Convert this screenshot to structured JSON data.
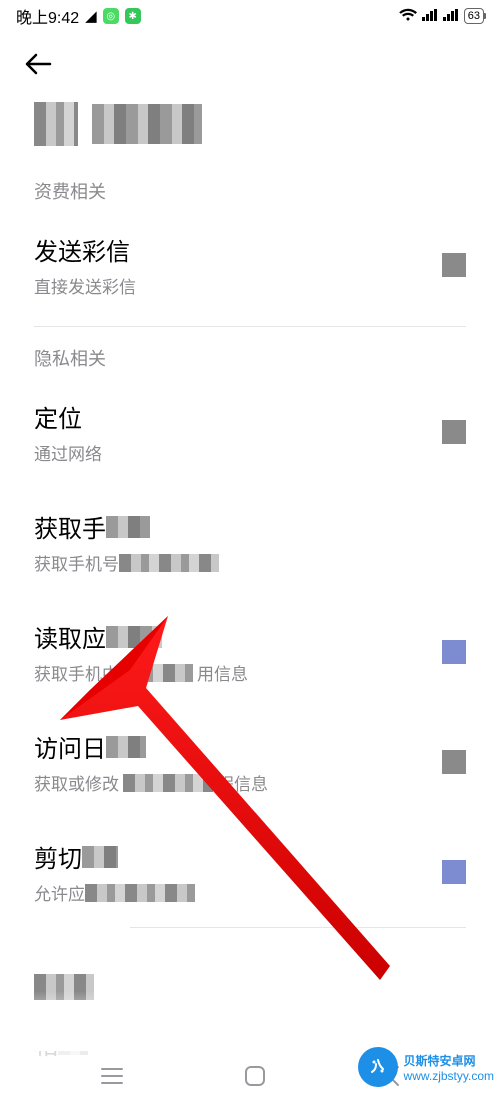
{
  "status": {
    "time": "晚上9:42",
    "battery": "63"
  },
  "sections": {
    "fee": "资费相关",
    "privacy": "隐私相关"
  },
  "rows": {
    "mms": {
      "title": "发送彩信",
      "sub": "直接发送彩信"
    },
    "location": {
      "title": "定位",
      "sub": "通过网络"
    },
    "phone": {
      "title_prefix": "获取手",
      "sub_prefix": "获取手机号"
    },
    "apps": {
      "title_prefix": "读取应",
      "sub_prefix": "获取手机中",
      "sub_suffix": "用信息"
    },
    "calendar": {
      "title_prefix": "访问日",
      "sub_prefix": "获取或修改",
      "sub_suffix": "程信息"
    },
    "clipboard": {
      "title_prefix": "剪切",
      "sub_prefix": "允许应"
    },
    "camera": {
      "title_prefix": "相"
    }
  },
  "watermark": {
    "cn": "贝斯特安卓网",
    "url": "www.zjbstyy.com"
  }
}
